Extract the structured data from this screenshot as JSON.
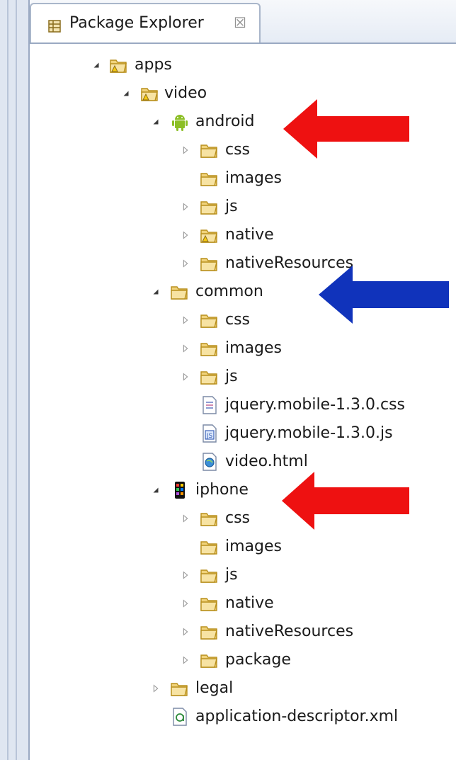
{
  "tab": {
    "title": "Package Explorer",
    "close_glyph": "☒"
  },
  "tree": {
    "apps": "apps",
    "video": "video",
    "android": "android",
    "android_css": "css",
    "android_images": "images",
    "android_js": "js",
    "android_native": "native",
    "android_nativeResources": "nativeResources",
    "common": "common",
    "common_css": "css",
    "common_images": "images",
    "common_js": "js",
    "common_jquery_css": "jquery.mobile-1.3.0.css",
    "common_jquery_js": "jquery.mobile-1.3.0.js",
    "common_video_html": "video.html",
    "iphone": "iphone",
    "iphone_css": "css",
    "iphone_images": "images",
    "iphone_js": "js",
    "iphone_native": "native",
    "iphone_nativeResources": "nativeResources",
    "iphone_package": "package",
    "legal": "legal",
    "app_descriptor": "application-descriptor.xml"
  },
  "colors": {
    "red_arrow": "#ee1111",
    "blue_arrow": "#1033bb",
    "folder": "#e8c65a"
  }
}
